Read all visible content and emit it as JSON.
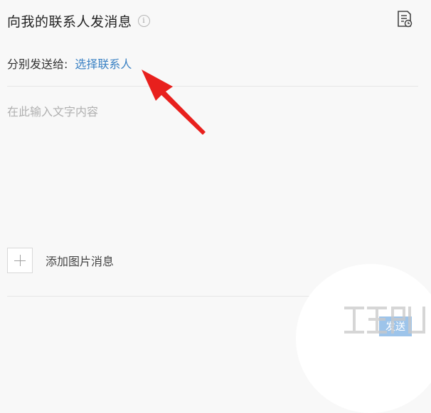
{
  "header": {
    "title": "向我的联系人发消息",
    "info_glyph": "i",
    "info_icon": "info-icon",
    "history_icon": "message-history-icon"
  },
  "recipients": {
    "label": "分别发送给:",
    "select_link": "选择联系人"
  },
  "message": {
    "placeholder": "在此输入文字内容",
    "value": ""
  },
  "attachment": {
    "add_icon": "plus-icon",
    "label": "添加图片消息"
  },
  "footer": {
    "send_label": "发送"
  },
  "colors": {
    "background": "#f8f8f8",
    "link": "#3b82c4",
    "send_button": "#9dc4ea",
    "annotation_arrow": "#e8201d"
  }
}
